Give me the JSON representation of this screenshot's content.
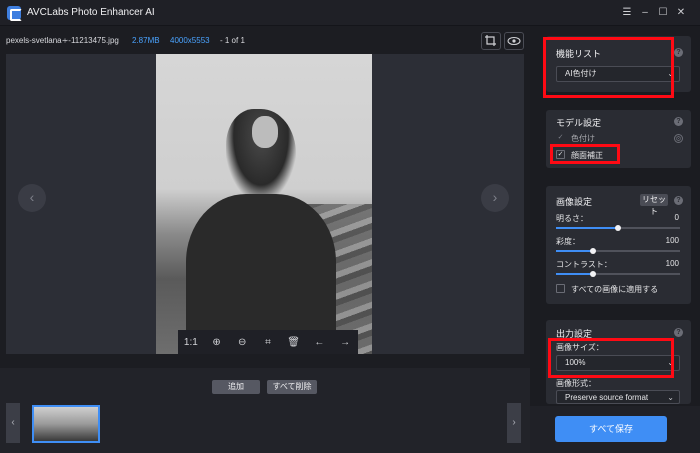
{
  "app": {
    "title": "AVCLabs Photo Enhancer AI"
  },
  "window": {
    "menu_icon": "☰",
    "minimize_icon": "–",
    "maximize_icon": "☐",
    "close_icon": "✕"
  },
  "file": {
    "name": "pexels-svetlana∻-11213475.jpg",
    "size": "2.87MB",
    "dims": "4000x5553",
    "count": "- 1 of 1"
  },
  "viewer": {
    "toolbar": {
      "ratio": "1:1",
      "zoom_in_icon": "⊕",
      "zoom_out_icon": "⊖",
      "crop_icon": "⌗",
      "delete_icon": "🗑",
      "prev_icon": "←",
      "next_icon": "→"
    },
    "prev_arrow": "‹",
    "next_arrow": "›"
  },
  "bottom": {
    "add_label": "追加",
    "delete_all_label": "すべて削除",
    "left_arrow": "‹",
    "right_arrow": "›"
  },
  "sidebar": {
    "function_list": {
      "title": "機能リスト",
      "selected": "AI色付け"
    },
    "model_settings": {
      "title": "モデル設定",
      "colorize": "色付け",
      "face_enhance": "顔面補正"
    },
    "image_settings": {
      "title": "画像設定",
      "reset": "リセット",
      "brightness": {
        "label": "明るさ：",
        "value": "0",
        "fraction": 0.5
      },
      "saturation": {
        "label": "彩度：",
        "value": "100",
        "fraction": 0.3
      },
      "contrast": {
        "label": "コントラスト：",
        "value": "100",
        "fraction": 0.3
      },
      "apply_all": "すべての画像に適用する"
    },
    "output_settings": {
      "title": "出力設定",
      "size_label": "画像サイズ：",
      "size_value": "100%",
      "format_label": "画像形式：",
      "format_value": "Preserve source format"
    },
    "save_all": "すべて保存"
  },
  "colors": {
    "accent": "#3f8ef5",
    "highlight": "#ff0a14"
  }
}
